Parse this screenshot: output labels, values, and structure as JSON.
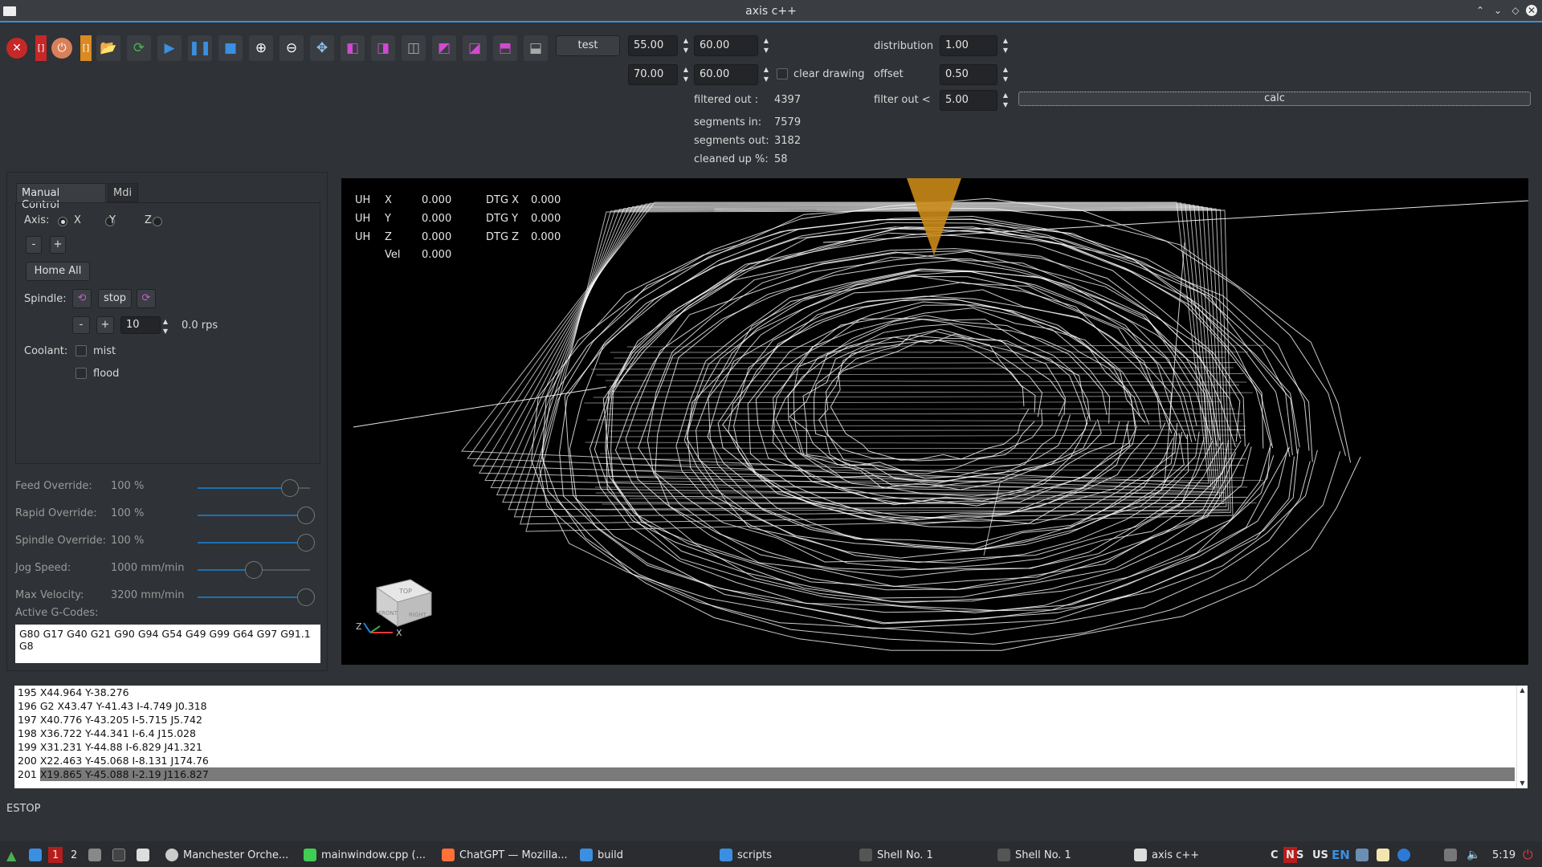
{
  "window": {
    "title": "axis c++"
  },
  "toolbar": {
    "test_label": "test",
    "spin1": "55.00",
    "spin2": "60.00",
    "spin3": "70.00",
    "spin4": "60.00",
    "clear_drawing_label": "clear drawing",
    "distribution_label": "distribution",
    "distribution_value": "1.00",
    "offset_label": "offset",
    "offset_value": "0.50",
    "filter_label": "filter out <",
    "filter_value": "5.00",
    "calc_label": "calc"
  },
  "stats": {
    "filtered_label": "filtered out :",
    "filtered_value": "4397",
    "seg_in_label": "segments in:",
    "seg_in_value": "7579",
    "seg_out_label": "segments out:",
    "seg_out_value": "3182",
    "cleaned_label": "cleaned up %:",
    "cleaned_value": "58"
  },
  "tabs": [
    "Manual Control",
    "Mdi"
  ],
  "manual": {
    "axis_label": "Axis:",
    "axis_x": "X",
    "axis_y": "Y",
    "axis_z": "Z",
    "minus": "-",
    "plus": "+",
    "home_all": "Home All",
    "spindle_label": "Spindle:",
    "stop": "stop",
    "spindle_speed": "10",
    "rps": "0.0 rps",
    "coolant_label": "Coolant:",
    "mist": "mist",
    "flood": "flood"
  },
  "overrides": [
    {
      "label": "Feed Override:",
      "value": "100 %",
      "fraction": 0.82
    },
    {
      "label": "Rapid Override:",
      "value": "100 %",
      "fraction": 1.0
    },
    {
      "label": "Spindle Override:",
      "value": "100 %",
      "fraction": 1.0
    },
    {
      "label": "Jog Speed:",
      "value": "1000 mm/min",
      "fraction": 0.5
    },
    {
      "label": "Max Velocity:",
      "value": "3200 mm/min",
      "fraction": 1.0
    }
  ],
  "active_gcodes": {
    "label": "Active G-Codes:",
    "text": "G80 G17 G40 G21 G90 G94 G54 G49 G99 G64 G97 G91.1 G8"
  },
  "dro": [
    {
      "prefix": "UH",
      "axis": "X",
      "value": "0.000",
      "dtg_label": "DTG X",
      "dtg_value": "0.000"
    },
    {
      "prefix": "UH",
      "axis": "Y",
      "value": "0.000",
      "dtg_label": "DTG Y",
      "dtg_value": "0.000"
    },
    {
      "prefix": "UH",
      "axis": "Z",
      "value": "0.000",
      "dtg_label": "DTG Z",
      "dtg_value": "0.000"
    }
  ],
  "vel": {
    "label": "Vel",
    "value": "0.000"
  },
  "viewcube": {
    "top": "TOP",
    "front": "FRONT",
    "right": "RIGHT",
    "axis_z": "Z",
    "axis_x": "X"
  },
  "gcode_lines": [
    {
      "num": "195",
      "text": "X44.964 Y-38.276"
    },
    {
      "num": "196",
      "text": "G2 X43.47 Y-41.43 I-4.749 J0.318"
    },
    {
      "num": "197",
      "text": "X40.776 Y-43.205 I-5.715 J5.742"
    },
    {
      "num": "198",
      "text": "X36.722 Y-44.341 I-6.4 J15.028"
    },
    {
      "num": "199",
      "text": "X31.231 Y-44.88 I-6.829 J41.321"
    },
    {
      "num": "200",
      "text": "X22.463 Y-45.068 I-8.131 J174.76"
    },
    {
      "num": "201",
      "text": "X19.865 Y-45.088 I-2.19 J116.827"
    }
  ],
  "status": "ESTOP",
  "taskbar": {
    "ws1": "1",
    "ws2": "2",
    "items": [
      "Manchester Orche...",
      "mainwindow.cpp (...",
      "ChatGPT — Mozilla...",
      "build",
      "scripts",
      "Shell No. 1",
      "Shell No. 1",
      "axis c++"
    ],
    "tray": [
      "C",
      "N",
      "S",
      "US",
      "EN"
    ],
    "clock": "5:19"
  }
}
